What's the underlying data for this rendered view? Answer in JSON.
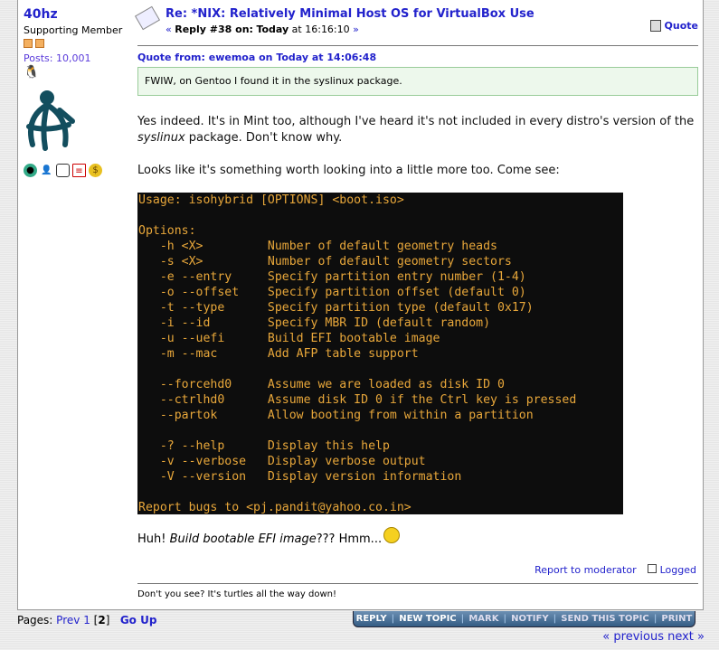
{
  "user": {
    "name": "40hz",
    "group": "Supporting Member",
    "posts": "Posts: 10,001"
  },
  "post": {
    "title": "Re: *NIX: Relatively Minimal Host OS for VirtualBox Use",
    "reply_prefix": "« ",
    "reply_label": "Reply #38 on:",
    "reply_day": "Today",
    "reply_time": " at 16:16:10 ",
    "reply_suffix": "»",
    "quote_button": "Quote",
    "quote_header": "Quote from: ewemoa on Today at 14:06:48",
    "quote_text": "FWIW, on Gentoo I found it in the syslinux package.",
    "para1_a": "Yes indeed. It's in Mint too, although I've heard it's not included in every distro's version of the ",
    "para1_em": "syslinux",
    "para1_b": " package. Don't know why.",
    "para2": "Looks like it's something worth looking into a little more too. Come see:",
    "terminal": "Usage: isohybrid [OPTIONS] <boot.iso>\n\nOptions:\n   -h <X>         Number of default geometry heads\n   -s <X>         Number of default geometry sectors\n   -e --entry     Specify partition entry number (1-4)\n   -o --offset    Specify partition offset (default 0)\n   -t --type      Specify partition type (default 0x17)\n   -i --id        Specify MBR ID (default random)\n   -u --uefi      Build EFI bootable image\n   -m --mac       Add AFP table support\n\n   --forcehd0     Assume we are loaded as disk ID 0\n   --ctrlhd0      Assume disk ID 0 if the Ctrl key is pressed\n   --partok       Allow booting from within a partition\n\n   -? --help      Display this help\n   -v --verbose   Display verbose output\n   -V --version   Display version information\n\nReport bugs to <pj.pandit@yahoo.co.in>",
    "huh_a": "Huh! ",
    "huh_em": "Build bootable EFI image",
    "huh_b": "??? Hmm...",
    "report": "Report to moderator",
    "logged": "Logged",
    "signature": "Don't you see? It's turtles all the way down!"
  },
  "pagination": {
    "label": "Pages: ",
    "prev": "Prev",
    "p1": "1",
    "current": "2",
    "go_up": "Go Up"
  },
  "actions": [
    "REPLY",
    "NEW TOPIC",
    "MARK",
    "NOTIFY",
    "SEND THIS TOPIC",
    "PRINT"
  ],
  "nav": {
    "prev": "« previous",
    "next": "next »"
  }
}
